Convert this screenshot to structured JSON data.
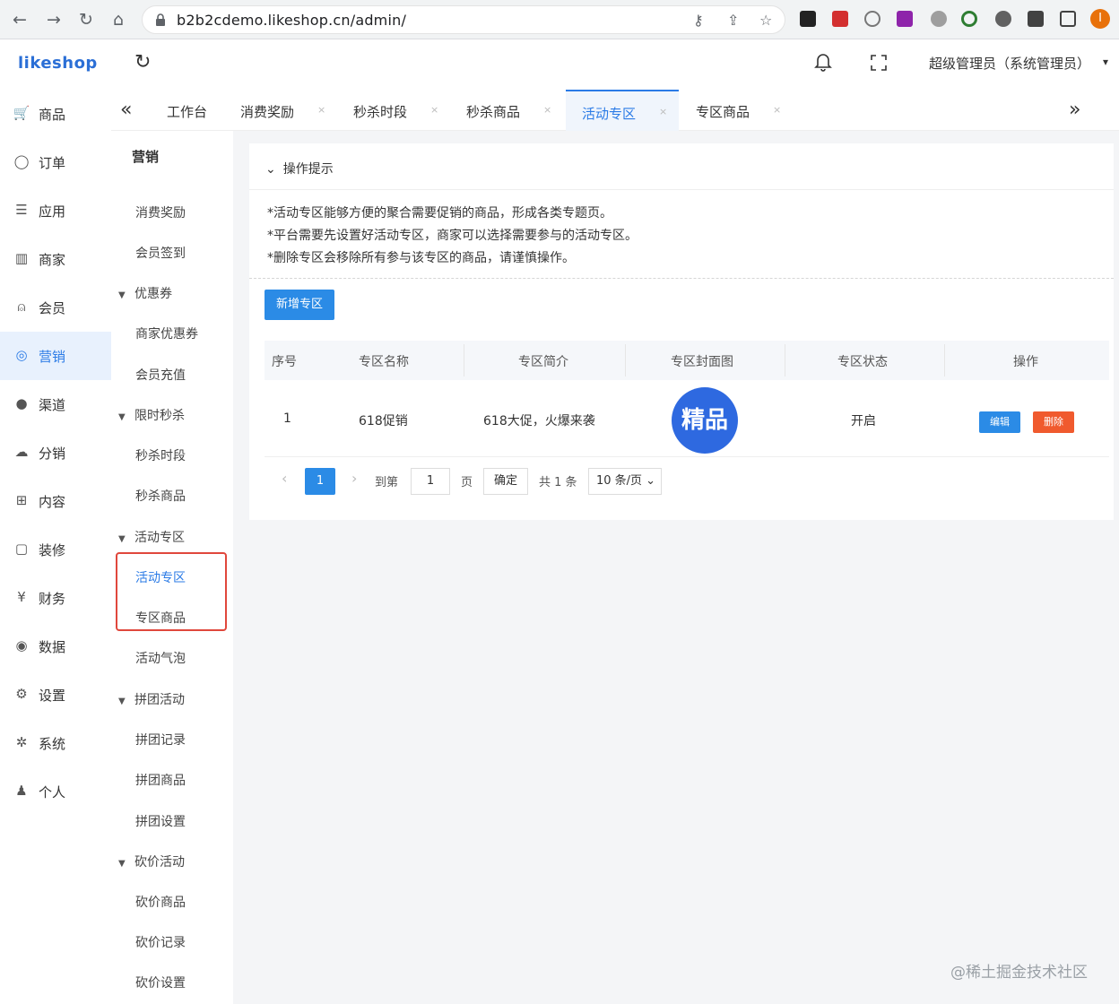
{
  "browser": {
    "url": "b2b2cdemo.likeshop.cn/admin/",
    "back": "←",
    "forward": "→",
    "reload": "↻",
    "home": "⌂",
    "key_icon": "⚷",
    "share_icon": "⇪",
    "star_icon": "☆",
    "profile_initial": "I",
    "colors": {
      "profile": "#e8710a"
    }
  },
  "header": {
    "logo": "likeshop",
    "refresh": "↻",
    "user": "超级管理员（系统管理员）",
    "user_caret": "▾"
  },
  "sidebar": {
    "items": [
      {
        "icon": "🛒",
        "label": "商品"
      },
      {
        "icon": "◯",
        "label": "订单"
      },
      {
        "icon": "☰",
        "label": "应用"
      },
      {
        "icon": "▥",
        "label": "商家"
      },
      {
        "icon": "⍝",
        "label": "会员"
      },
      {
        "icon": "◎",
        "label": "营销"
      },
      {
        "icon": "●",
        "label": "渠道"
      },
      {
        "icon": "☁",
        "label": "分销"
      },
      {
        "icon": "⊞",
        "label": "内容"
      },
      {
        "icon": "▢",
        "label": "装修"
      },
      {
        "icon": "¥",
        "label": "财务"
      },
      {
        "icon": "◉",
        "label": "数据"
      },
      {
        "icon": "⚙",
        "label": "设置"
      },
      {
        "icon": "✲",
        "label": "系统"
      },
      {
        "icon": "♟",
        "label": "个人"
      }
    ]
  },
  "submenu": {
    "title": "营销",
    "entries": [
      {
        "type": "item",
        "label": "消费奖励"
      },
      {
        "type": "item",
        "label": "会员签到"
      },
      {
        "type": "group",
        "label": "优惠券"
      },
      {
        "type": "item",
        "label": "商家优惠券"
      },
      {
        "type": "item",
        "label": "会员充值"
      },
      {
        "type": "group",
        "label": "限时秒杀"
      },
      {
        "type": "item",
        "label": "秒杀时段"
      },
      {
        "type": "item",
        "label": "秒杀商品"
      },
      {
        "type": "group",
        "label": "活动专区"
      },
      {
        "type": "item",
        "label": "活动专区"
      },
      {
        "type": "item",
        "label": "专区商品"
      },
      {
        "type": "item",
        "label": "活动气泡"
      },
      {
        "type": "group",
        "label": "拼团活动"
      },
      {
        "type": "item",
        "label": "拼团记录"
      },
      {
        "type": "item",
        "label": "拼团商品"
      },
      {
        "type": "item",
        "label": "拼团设置"
      },
      {
        "type": "group",
        "label": "砍价活动"
      },
      {
        "type": "item",
        "label": "砍价商品"
      },
      {
        "type": "item",
        "label": "砍价记录"
      },
      {
        "type": "item",
        "label": "砍价设置"
      }
    ],
    "caret": "▼"
  },
  "tabs": {
    "left_arrow": "«",
    "right_arrow": "»",
    "close": "×",
    "items": [
      {
        "label": "工作台"
      },
      {
        "label": "消费奖励"
      },
      {
        "label": "秒杀时段"
      },
      {
        "label": "秒杀商品"
      },
      {
        "label": "活动专区"
      },
      {
        "label": "专区商品"
      }
    ]
  },
  "tips": {
    "header": "操作提示",
    "toggle": "⌄",
    "lines": [
      "*活动专区能够方便的聚合需要促销的商品，形成各类专题页。",
      "*平台需要先设置好活动专区，商家可以选择需要参与的活动专区。",
      "*删除专区会移除所有参与该专区的商品，请谨慎操作。"
    ]
  },
  "toolbar": {
    "add_label": "新增专区"
  },
  "table": {
    "columns": [
      "序号",
      "专区名称",
      "专区简介",
      "专区封面图",
      "专区状态",
      "操作"
    ],
    "rows": [
      {
        "index": "1",
        "name": "618促销",
        "intro": "618大促，火爆来袭",
        "cover_text": "精品",
        "status": "开启",
        "edit": "编辑",
        "delete": "删除"
      }
    ]
  },
  "pagination": {
    "prev": "‹",
    "next": "›",
    "current": "1",
    "goto_label": "到第",
    "goto_value": "1",
    "page_unit": "页",
    "confirm": "确定",
    "total": "共 1 条",
    "page_size": "10 条/页",
    "size_caret": "⌄"
  },
  "watermark": "@稀土掘金技术社区",
  "colors": {
    "primary": "#2b7be6",
    "danger": "#f05a2e",
    "highlight": "#e0473c",
    "cover": "#2e69e0"
  }
}
